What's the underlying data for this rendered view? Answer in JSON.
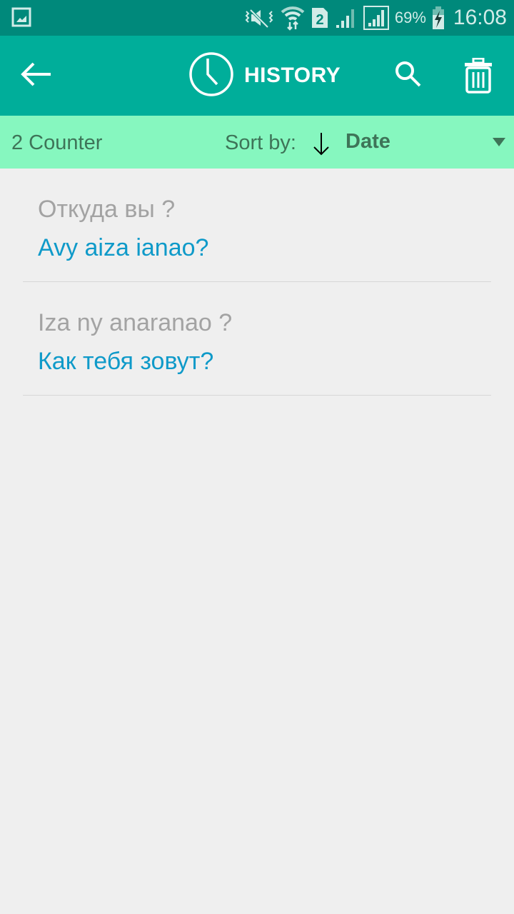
{
  "status_bar": {
    "icons": [
      "gallery-icon",
      "mute-vibrate-icon",
      "wifi-icon",
      "sim-2-icon",
      "signal-weak-icon",
      "signal-icon",
      "battery-charging-icon"
    ],
    "battery": "69%",
    "time": "16:08"
  },
  "app_bar": {
    "title": "HISTORY",
    "back_icon": "arrow-left-icon",
    "title_icon": "clock-icon",
    "search_icon": "search-icon",
    "delete_icon": "trash-icon"
  },
  "sort_bar": {
    "counter": "2 Counter",
    "sort_label": "Sort by:",
    "sort_direction": "descending",
    "sort_value": "Date"
  },
  "history": [
    {
      "source": "Откуда вы ?",
      "target": "Avy aiza ianao?"
    },
    {
      "source": "Iza ny anaranao ?",
      "target": "Как тебя зовут?"
    }
  ],
  "colors": {
    "status_bar": "#00897b",
    "app_bar": "#00ae9a",
    "sort_bar": "#86f7bf",
    "source_text": "#a3a3a3",
    "target_text": "#0f9ac9"
  }
}
